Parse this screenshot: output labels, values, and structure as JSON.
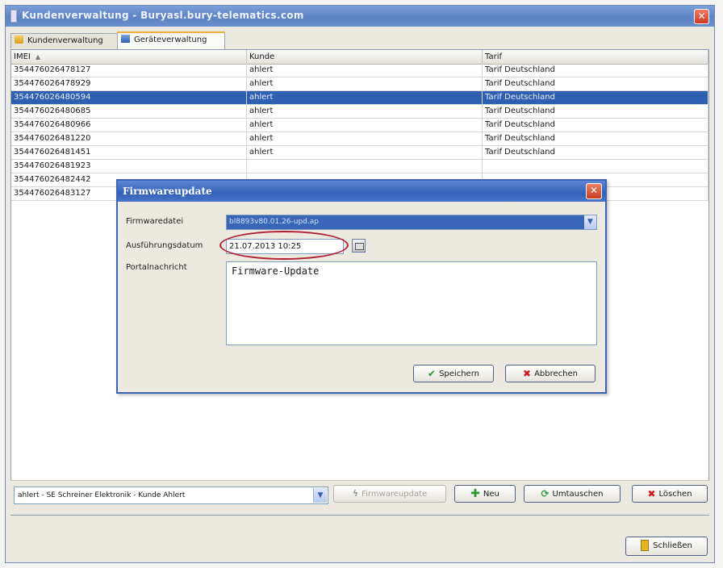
{
  "window": {
    "title": "Kundenverwaltung - Buryasl.bury-telematics.com",
    "close": "✕"
  },
  "tabs": [
    {
      "label": "Kundenverwaltung"
    },
    {
      "label": "Geräteverwaltung"
    }
  ],
  "table": {
    "headers": {
      "imei": "IMEI",
      "kunde": "Kunde",
      "tarif": "Tarif"
    },
    "sort_indicator": "▲",
    "rows": [
      {
        "imei": "354476026478127",
        "kunde": "ahlert",
        "tarif": "Tarif Deutschland"
      },
      {
        "imei": "354476026478929",
        "kunde": "ahlert",
        "tarif": "Tarif Deutschland"
      },
      {
        "imei": "354476026480594",
        "kunde": "ahlert",
        "tarif": "Tarif Deutschland",
        "selected": true
      },
      {
        "imei": "354476026480685",
        "kunde": "ahlert",
        "tarif": "Tarif Deutschland"
      },
      {
        "imei": "354476026480966",
        "kunde": "ahlert",
        "tarif": "Tarif Deutschland"
      },
      {
        "imei": "354476026481220",
        "kunde": "ahlert",
        "tarif": "Tarif Deutschland"
      },
      {
        "imei": "354476026481451",
        "kunde": "ahlert",
        "tarif": "Tarif Deutschland"
      },
      {
        "imei": "354476026481923",
        "kunde": "",
        "tarif": ""
      },
      {
        "imei": "354476026482442",
        "kunde": "",
        "tarif": ""
      },
      {
        "imei": "354476026483127",
        "kunde": "",
        "tarif": ""
      }
    ]
  },
  "bottom": {
    "customer_select": "ahlert - SE Schreiner Elektronik - Kunde Ahlert",
    "firmware_button": "Firmwareupdate",
    "new_button": "Neu",
    "swap_button": "Umtauschen",
    "delete_button": "Löschen",
    "close_button": "Schließen"
  },
  "dialog": {
    "title": "Firmwareupdate",
    "firmware_label": "Firmwaredatei",
    "firmware_value": "bl8893v80.01.26-upd.ap",
    "date_label": "Ausführungsdatum",
    "date_value": "21.07.2013 10:25",
    "message_label": "Portalnachricht",
    "message_value": "Firmware-Update",
    "save_button": "Speichern",
    "cancel_button": "Abbrechen"
  }
}
